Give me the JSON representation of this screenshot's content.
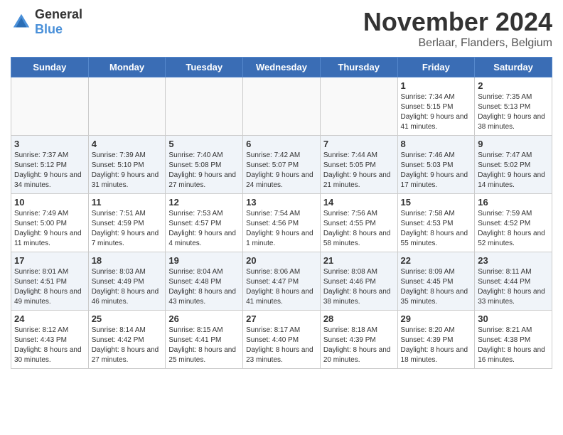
{
  "header": {
    "logo_general": "General",
    "logo_blue": "Blue",
    "month_title": "November 2024",
    "location": "Berlaar, Flanders, Belgium"
  },
  "days_of_week": [
    "Sunday",
    "Monday",
    "Tuesday",
    "Wednesday",
    "Thursday",
    "Friday",
    "Saturday"
  ],
  "weeks": [
    [
      {
        "num": "",
        "info": ""
      },
      {
        "num": "",
        "info": ""
      },
      {
        "num": "",
        "info": ""
      },
      {
        "num": "",
        "info": ""
      },
      {
        "num": "",
        "info": ""
      },
      {
        "num": "1",
        "info": "Sunrise: 7:34 AM\nSunset: 5:15 PM\nDaylight: 9 hours and 41 minutes."
      },
      {
        "num": "2",
        "info": "Sunrise: 7:35 AM\nSunset: 5:13 PM\nDaylight: 9 hours and 38 minutes."
      }
    ],
    [
      {
        "num": "3",
        "info": "Sunrise: 7:37 AM\nSunset: 5:12 PM\nDaylight: 9 hours and 34 minutes."
      },
      {
        "num": "4",
        "info": "Sunrise: 7:39 AM\nSunset: 5:10 PM\nDaylight: 9 hours and 31 minutes."
      },
      {
        "num": "5",
        "info": "Sunrise: 7:40 AM\nSunset: 5:08 PM\nDaylight: 9 hours and 27 minutes."
      },
      {
        "num": "6",
        "info": "Sunrise: 7:42 AM\nSunset: 5:07 PM\nDaylight: 9 hours and 24 minutes."
      },
      {
        "num": "7",
        "info": "Sunrise: 7:44 AM\nSunset: 5:05 PM\nDaylight: 9 hours and 21 minutes."
      },
      {
        "num": "8",
        "info": "Sunrise: 7:46 AM\nSunset: 5:03 PM\nDaylight: 9 hours and 17 minutes."
      },
      {
        "num": "9",
        "info": "Sunrise: 7:47 AM\nSunset: 5:02 PM\nDaylight: 9 hours and 14 minutes."
      }
    ],
    [
      {
        "num": "10",
        "info": "Sunrise: 7:49 AM\nSunset: 5:00 PM\nDaylight: 9 hours and 11 minutes."
      },
      {
        "num": "11",
        "info": "Sunrise: 7:51 AM\nSunset: 4:59 PM\nDaylight: 9 hours and 7 minutes."
      },
      {
        "num": "12",
        "info": "Sunrise: 7:53 AM\nSunset: 4:57 PM\nDaylight: 9 hours and 4 minutes."
      },
      {
        "num": "13",
        "info": "Sunrise: 7:54 AM\nSunset: 4:56 PM\nDaylight: 9 hours and 1 minute."
      },
      {
        "num": "14",
        "info": "Sunrise: 7:56 AM\nSunset: 4:55 PM\nDaylight: 8 hours and 58 minutes."
      },
      {
        "num": "15",
        "info": "Sunrise: 7:58 AM\nSunset: 4:53 PM\nDaylight: 8 hours and 55 minutes."
      },
      {
        "num": "16",
        "info": "Sunrise: 7:59 AM\nSunset: 4:52 PM\nDaylight: 8 hours and 52 minutes."
      }
    ],
    [
      {
        "num": "17",
        "info": "Sunrise: 8:01 AM\nSunset: 4:51 PM\nDaylight: 8 hours and 49 minutes."
      },
      {
        "num": "18",
        "info": "Sunrise: 8:03 AM\nSunset: 4:49 PM\nDaylight: 8 hours and 46 minutes."
      },
      {
        "num": "19",
        "info": "Sunrise: 8:04 AM\nSunset: 4:48 PM\nDaylight: 8 hours and 43 minutes."
      },
      {
        "num": "20",
        "info": "Sunrise: 8:06 AM\nSunset: 4:47 PM\nDaylight: 8 hours and 41 minutes."
      },
      {
        "num": "21",
        "info": "Sunrise: 8:08 AM\nSunset: 4:46 PM\nDaylight: 8 hours and 38 minutes."
      },
      {
        "num": "22",
        "info": "Sunrise: 8:09 AM\nSunset: 4:45 PM\nDaylight: 8 hours and 35 minutes."
      },
      {
        "num": "23",
        "info": "Sunrise: 8:11 AM\nSunset: 4:44 PM\nDaylight: 8 hours and 33 minutes."
      }
    ],
    [
      {
        "num": "24",
        "info": "Sunrise: 8:12 AM\nSunset: 4:43 PM\nDaylight: 8 hours and 30 minutes."
      },
      {
        "num": "25",
        "info": "Sunrise: 8:14 AM\nSunset: 4:42 PM\nDaylight: 8 hours and 27 minutes."
      },
      {
        "num": "26",
        "info": "Sunrise: 8:15 AM\nSunset: 4:41 PM\nDaylight: 8 hours and 25 minutes."
      },
      {
        "num": "27",
        "info": "Sunrise: 8:17 AM\nSunset: 4:40 PM\nDaylight: 8 hours and 23 minutes."
      },
      {
        "num": "28",
        "info": "Sunrise: 8:18 AM\nSunset: 4:39 PM\nDaylight: 8 hours and 20 minutes."
      },
      {
        "num": "29",
        "info": "Sunrise: 8:20 AM\nSunset: 4:39 PM\nDaylight: 8 hours and 18 minutes."
      },
      {
        "num": "30",
        "info": "Sunrise: 8:21 AM\nSunset: 4:38 PM\nDaylight: 8 hours and 16 minutes."
      }
    ]
  ]
}
